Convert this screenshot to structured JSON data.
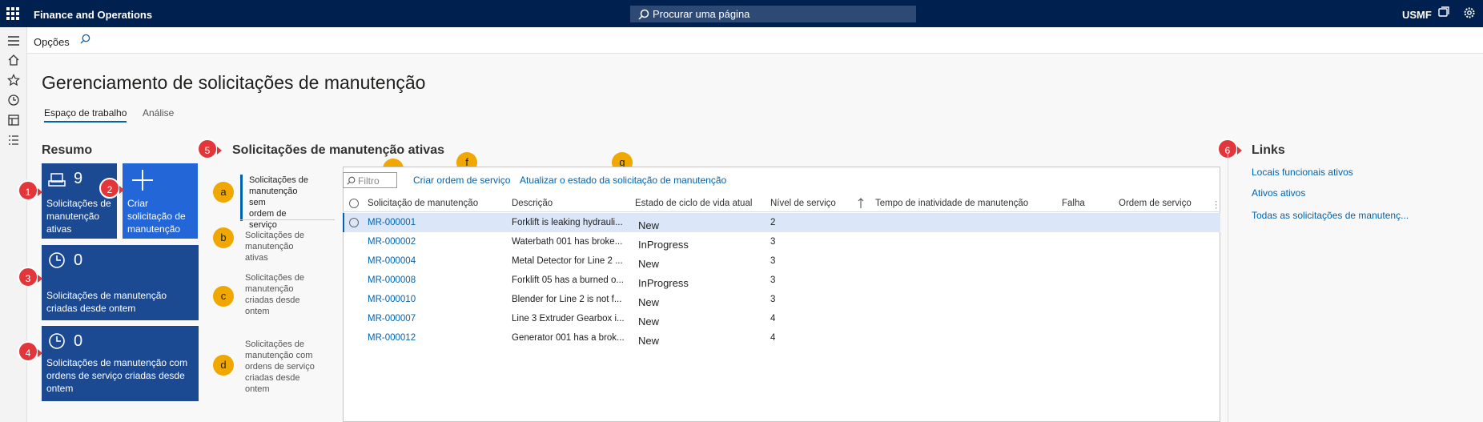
{
  "topbar": {
    "app_title": "Finance and Operations",
    "search_placeholder": "Procurar uma página",
    "company": "USMF"
  },
  "actionbar": {
    "options_label": "Opções"
  },
  "page": {
    "title": "Gerenciamento de solicitações de manutenção",
    "tabs": [
      "Espaço de trabalho",
      "Análise"
    ]
  },
  "summary": {
    "title": "Resumo",
    "tiles": [
      {
        "count": "9",
        "label_lines": [
          "Solicitações de",
          "manutenção",
          "ativas"
        ]
      },
      {
        "label_lines": [
          "Criar",
          "solicitação de",
          "manutenção"
        ]
      },
      {
        "count": "0",
        "label_lines": [
          "Solicitações de manutenção",
          "criadas desde ontem"
        ]
      },
      {
        "count": "0",
        "label_lines": [
          "Solicitações de manutenção com",
          "ordens de serviço criadas desde",
          "ontem"
        ]
      }
    ]
  },
  "callouts": {
    "red": [
      "1",
      "2",
      "3",
      "4",
      "5",
      "6"
    ],
    "yellow": [
      "a",
      "b",
      "c",
      "d",
      "e",
      "f",
      "g"
    ]
  },
  "active": {
    "title": "Solicitações de manutenção ativas",
    "views": [
      [
        "Solicitações de",
        "manutenção sem",
        "ordem de serviço"
      ],
      [
        "Solicitações de",
        "manutenção ativas"
      ],
      [
        "Solicitações de",
        "manutenção",
        "criadas desde",
        "ontem"
      ],
      [
        "Solicitações de",
        "manutenção com",
        "ordens de serviço",
        "criadas desde",
        "ontem"
      ]
    ],
    "filter_placeholder": "Filtro",
    "actions": [
      "Criar ordem de serviço",
      "Atualizar o estado da solicitação de manutenção"
    ],
    "columns": [
      "Solicitação de manutenção",
      "Descrição",
      "Estado de ciclo de vida atual",
      "Nível de serviço",
      "Tempo de inatividade de manutenção",
      "Falha",
      "Ordem de serviço"
    ],
    "rows": [
      {
        "id": "MR-000001",
        "desc": "Forklift is leaking hydrauli...",
        "state": "New",
        "level": "2"
      },
      {
        "id": "MR-000002",
        "desc": "Waterbath 001 has broke...",
        "state": "InProgress",
        "level": "3"
      },
      {
        "id": "MR-000004",
        "desc": "Metal Detector for Line 2 ...",
        "state": "New",
        "level": "3"
      },
      {
        "id": "MR-000008",
        "desc": "Forklift 05 has a burned o...",
        "state": "InProgress",
        "level": "3"
      },
      {
        "id": "MR-000010",
        "desc": "Blender for Line 2 is not f...",
        "state": "New",
        "level": "3"
      },
      {
        "id": "MR-000007",
        "desc": "Line 3 Extruder Gearbox i...",
        "state": "New",
        "level": "4"
      },
      {
        "id": "MR-000012",
        "desc": "Generator 001 has a brok...",
        "state": "New",
        "level": "4"
      }
    ]
  },
  "links": {
    "title": "Links",
    "items": [
      "Locais funcionais ativos",
      "Ativos ativos",
      "Todas as solicitações de manutenç..."
    ]
  }
}
